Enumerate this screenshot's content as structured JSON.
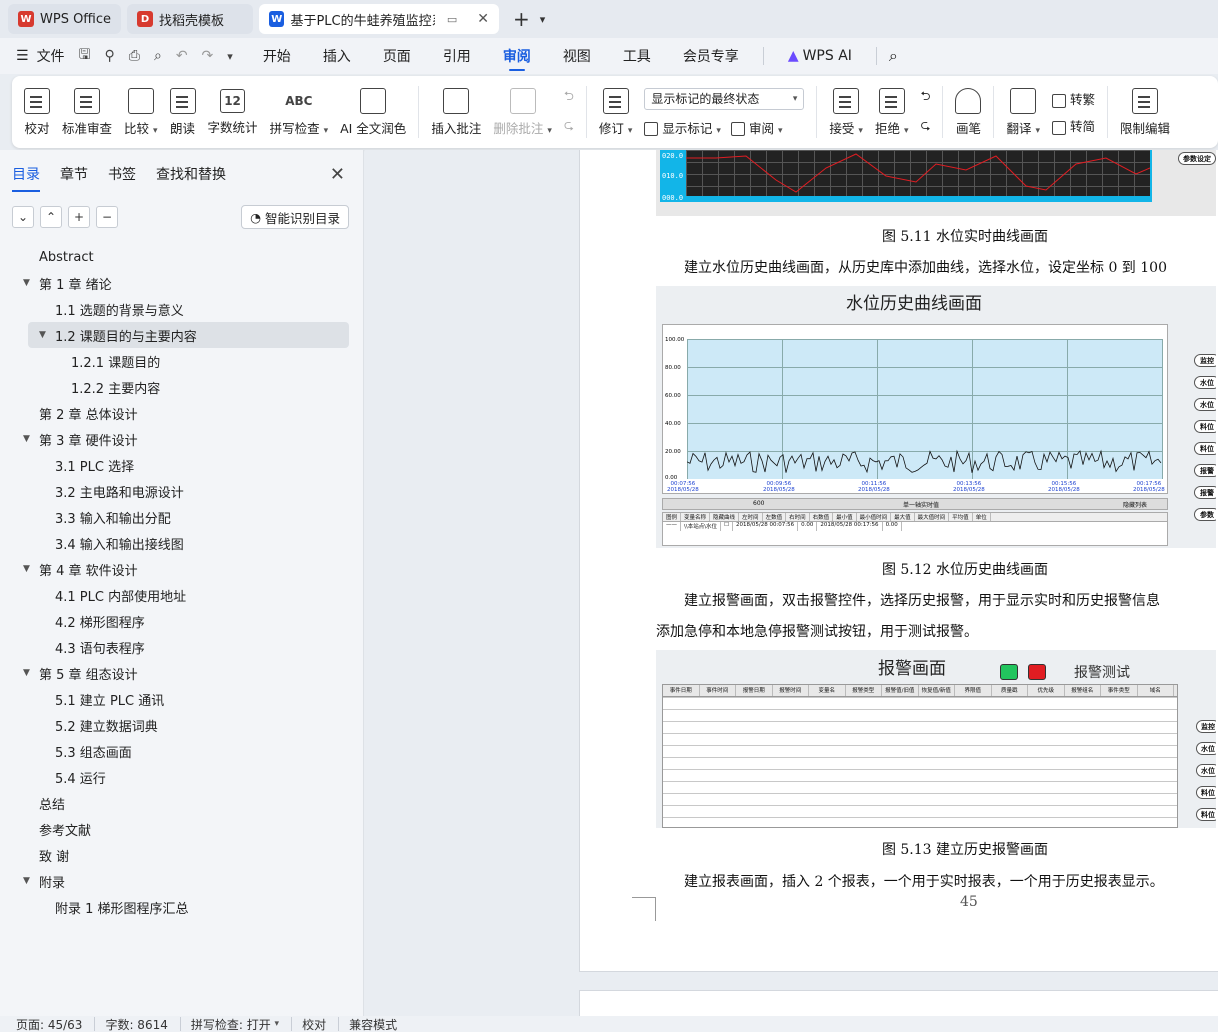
{
  "tabs": [
    {
      "label": "WPS Office",
      "color": "#d73a2f"
    },
    {
      "label": "找稻壳模板",
      "color": "#d73a2f"
    },
    {
      "label": "基于PLC的牛蛙养殖监控系统",
      "color": "#1a5ee0"
    }
  ],
  "menu": {
    "file": "文件",
    "items": [
      "开始",
      "插入",
      "页面",
      "引用",
      "审阅",
      "视图",
      "工具",
      "会员专享"
    ],
    "active": "审阅",
    "wps_ai": "WPS AI"
  },
  "ribbon": {
    "proofread": "校对",
    "standard_review": "标准审查",
    "compare": "比较",
    "read_aloud": "朗读",
    "word_count": "字数统计",
    "word_count_icon": "12",
    "spell_check": "拼写检查",
    "spell_icon": "ABC",
    "ai_polish": "AI 全文润色",
    "insert_comment": "插入批注",
    "delete_comment": "删除批注",
    "revise": "修订",
    "markup_select": "显示标记的最终状态",
    "show_markup": "显示标记",
    "review": "审阅",
    "accept": "接受",
    "reject": "拒绝",
    "pen": "画笔",
    "translate": "翻译",
    "trad": "转繁",
    "simp": "转简",
    "restrict": "限制编辑"
  },
  "nav": {
    "tabs": [
      "目录",
      "章节",
      "书签",
      "查找和替换"
    ],
    "smart_toc": "智能识别目录",
    "toc": [
      {
        "text": "Abstract",
        "level": 0,
        "tri": false
      },
      {
        "text": "第 1 章  绪论",
        "level": 0,
        "tri": true
      },
      {
        "text": "1.1  选题的背景与意义",
        "level": 1,
        "tri": false
      },
      {
        "text": "1.2  课题目的与主要内容",
        "level": 1,
        "tri": true,
        "selected": true
      },
      {
        "text": "1.2.1  课题目的",
        "level": 2,
        "tri": false
      },
      {
        "text": "1.2.2  主要内容",
        "level": 2,
        "tri": false
      },
      {
        "text": "第 2 章    总体设计",
        "level": 0,
        "tri": false
      },
      {
        "text": "第 3 章    硬件设计",
        "level": 0,
        "tri": true
      },
      {
        "text": "3.1 PLC 选择",
        "level": 1,
        "tri": false
      },
      {
        "text": "3.2  主电路和电源设计",
        "level": 1,
        "tri": false
      },
      {
        "text": "3.3  输入和输出分配",
        "level": 1,
        "tri": false
      },
      {
        "text": "3.4  输入和输出接线图",
        "level": 1,
        "tri": false
      },
      {
        "text": "第 4 章    软件设计",
        "level": 0,
        "tri": true
      },
      {
        "text": "4.1 PLC 内部使用地址",
        "level": 1,
        "tri": false
      },
      {
        "text": "4.2  梯形图程序",
        "level": 1,
        "tri": false
      },
      {
        "text": "4.3  语句表程序",
        "level": 1,
        "tri": false
      },
      {
        "text": "第 5 章    组态设计",
        "level": 0,
        "tri": true
      },
      {
        "text": "5.1 建立 PLC 通讯",
        "level": 1,
        "tri": false
      },
      {
        "text": "5.2  建立数据词典",
        "level": 1,
        "tri": false
      },
      {
        "text": "5.3  组态画面",
        "level": 1,
        "tri": false
      },
      {
        "text": "5.4 运行",
        "level": 1,
        "tri": false
      },
      {
        "text": "总结",
        "level": 0,
        "tri": false
      },
      {
        "text": "参考文献",
        "level": 0,
        "tri": false
      },
      {
        "text": "致  谢",
        "level": 0,
        "tri": false
      },
      {
        "text": "附录",
        "level": 0,
        "tri": true
      },
      {
        "text": "附录 1  梯形图程序汇总",
        "level": 1,
        "tri": false
      }
    ]
  },
  "doc": {
    "fig1_labels": [
      "020.0",
      "010.0",
      "000.0"
    ],
    "fig1_button": "参数设定",
    "cap1": "图 5.11  水位实时曲线画面",
    "para1": "建立水位历史曲线画面，从历史库中添加曲线，选择水位，设定坐标 0 到 100",
    "fig2_title": "水位历史曲线画面",
    "fig2_ylabels": [
      "100.00",
      "80.00",
      "60.00",
      "40.00",
      "20.00",
      "0.00"
    ],
    "fig2_xlabels": [
      "00:07:56",
      "00:09:56",
      "00:11:56",
      "00:13:56",
      "00:15:56",
      "00:17:56"
    ],
    "fig2_date": "2018/05/28",
    "fig2_side": [
      "监控",
      "水位",
      "水位",
      "料位",
      "料位",
      "报警",
      "报警",
      "参数"
    ],
    "fig2_toolbar": [
      "600",
      "单一轴实时值",
      "隐藏列表"
    ],
    "fig2_table_header": [
      "图例",
      "变量名称",
      "隐藏曲线",
      "左时间",
      "左数值",
      "右时间",
      "右数值",
      "最小值",
      "最小值时间",
      "最大值",
      "最大值时间",
      "平均值",
      "单位"
    ],
    "fig2_table_row": [
      "——",
      "\\\\本站点\\水位",
      "☐",
      "2018/05/28 00:07:56",
      "0.00",
      "2018/05/28 00:17:56",
      "0.00"
    ],
    "cap2": "图 5.12  水位历史曲线画面",
    "para2": "建立报警画面，双击报警控件，选择历史报警，用于显示实时和历史报警信息",
    "para3": "添加急停和本地急停报警测试按钮，用于测试报警。",
    "fig3_title": "报警画面",
    "fig3_test": "报警测试",
    "fig3_headers": [
      "事件日期",
      "事件时间",
      "报警日期",
      "报警时间",
      "变量名",
      "报警类型",
      "报警值/旧值",
      "恢复值/新值",
      "界限值",
      "质量戳",
      "优先级",
      "报警组名",
      "事件类型",
      "域名"
    ],
    "fig3_side": [
      "监控",
      "水位",
      "水位",
      "料位",
      "料位"
    ],
    "cap3": "图 5.13  建立历史报警画面",
    "para4": "建立报表画面，插入 2 个报表，一个用于实时报表，一个用于历史报表显示。",
    "page_number": "45"
  },
  "status": {
    "page": "页面: 45/63",
    "words": "字数: 8614",
    "spell": "拼写检查: 打开",
    "proof": "校对",
    "compat": "兼容模式"
  },
  "colors": {
    "accent": "#1a5ee0",
    "green_button": "#22c55e",
    "red_button": "#e11d22"
  }
}
